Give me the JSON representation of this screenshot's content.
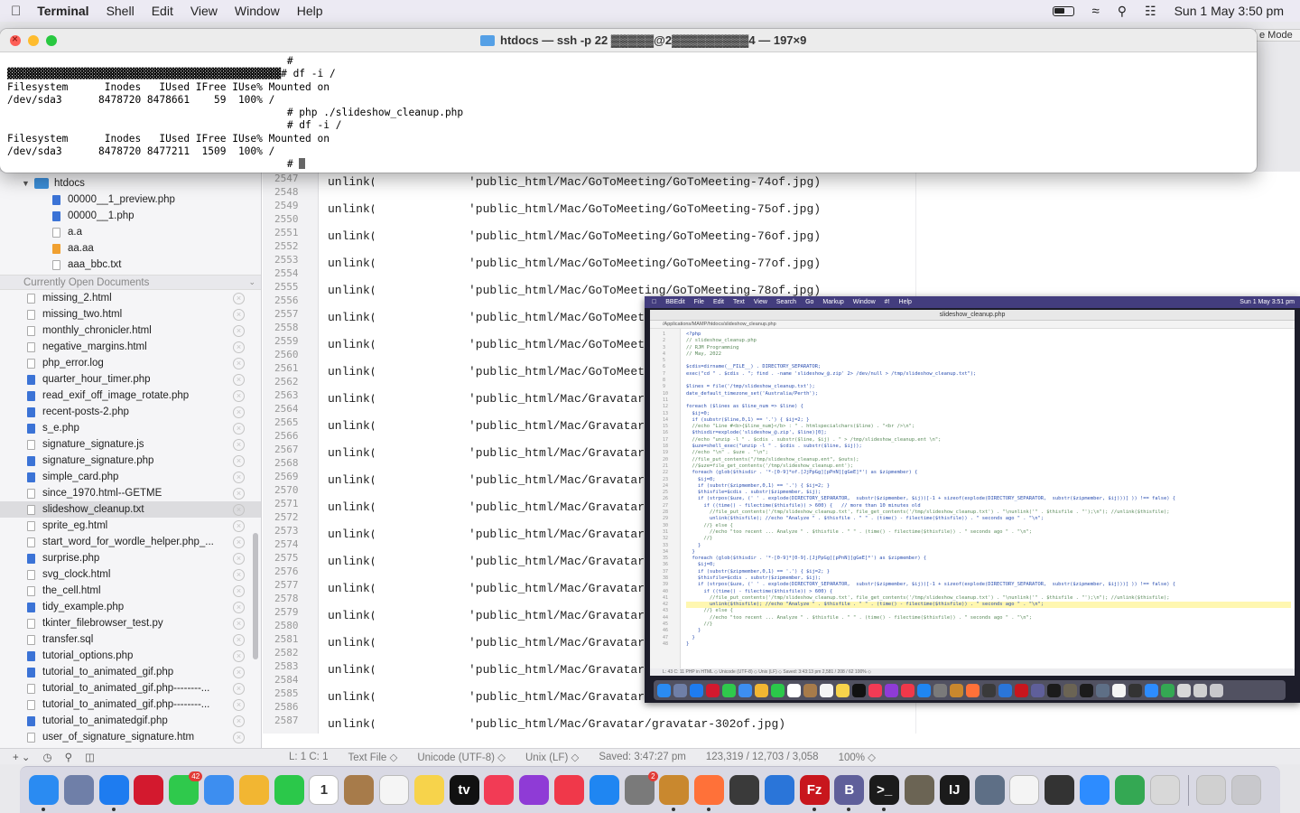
{
  "menubar": {
    "apple": "",
    "items": [
      "Terminal",
      "Shell",
      "Edit",
      "View",
      "Window",
      "Help"
    ],
    "clock": "Sun 1 May  3:50 pm"
  },
  "terminal": {
    "title": "htdocs — ssh -p 22 ▓▓▓▓▓@2▓▓▓▓▓▓▓▓▓4 — 197×9",
    "lines": [
      "                                              #",
      "▓▓▓▓▓▓▓▓▓▓▓▓▓▓▓▓▓▓▓▓▓▓▓▓▓▓▓▓▓▓▓▓▓▓▓▓▓▓▓▓▓▓▓▓▓# df -i /",
      "Filesystem      Inodes   IUsed IFree IUse% Mounted on",
      "/dev/sda3      8478720 8478661    59  100% /",
      "                                              # php ./slideshow_cleanup.php",
      "                                              # df -i /",
      "Filesystem      Inodes   IUsed IFree IUse% Mounted on",
      "/dev/sda3      8478720 8477211  1509  100% /",
      "                                              # "
    ],
    "behind_tab": "e Mode"
  },
  "sidebar": {
    "folder": "htdocs",
    "files": [
      {
        "name": "00000__1_preview.php",
        "type": "php"
      },
      {
        "name": "00000__1.php",
        "type": "php"
      },
      {
        "name": "a.a",
        "type": "txt"
      },
      {
        "name": "aa.aa",
        "type": "a"
      },
      {
        "name": "aaa_bbc.txt",
        "type": "txt"
      }
    ],
    "open_docs_header": "Currently Open Documents",
    "open_docs": [
      {
        "name": "missing_2.html",
        "type": "txt"
      },
      {
        "name": "missing_two.html",
        "type": "txt"
      },
      {
        "name": "monthly_chronicler.html",
        "type": "txt"
      },
      {
        "name": "negative_margins.html",
        "type": "txt"
      },
      {
        "name": "php_error.log",
        "type": "txt"
      },
      {
        "name": "quarter_hour_timer.php",
        "type": "php"
      },
      {
        "name": "read_exif_off_image_rotate.php",
        "type": "php"
      },
      {
        "name": "recent-posts-2.php",
        "type": "php"
      },
      {
        "name": "s_e.php",
        "type": "php"
      },
      {
        "name": "signature_signature.js",
        "type": "txt"
      },
      {
        "name": "signature_signature.php",
        "type": "php"
      },
      {
        "name": "simple_card.php",
        "type": "php"
      },
      {
        "name": "since_1970.html--GETME",
        "type": "txt"
      },
      {
        "name": "slideshow_cleanup.txt",
        "type": "txt",
        "selected": true
      },
      {
        "name": "sprite_eg.html",
        "type": "txt"
      },
      {
        "name": "start_word_for_wordle_helper.php_...",
        "type": "txt"
      },
      {
        "name": "surprise.php",
        "type": "php"
      },
      {
        "name": "svg_clock.html",
        "type": "txt"
      },
      {
        "name": "the_cell.html",
        "type": "txt"
      },
      {
        "name": "tidy_example.php",
        "type": "php"
      },
      {
        "name": "tkinter_filebrowser_test.py",
        "type": "txt"
      },
      {
        "name": "transfer.sql",
        "type": "txt"
      },
      {
        "name": "tutorial_options.php",
        "type": "php"
      },
      {
        "name": "tutorial_to_animated_gif.php",
        "type": "php"
      },
      {
        "name": "tutorial_to_animated_gif.php--------...",
        "type": "txt"
      },
      {
        "name": "tutorial_to_animated_gif.php--------...",
        "type": "txt"
      },
      {
        "name": "tutorial_to_animatedgif.php",
        "type": "php"
      },
      {
        "name": "user_of_signature_signature.htm",
        "type": "txt"
      },
      {
        "name": "user_of_signature_signature.html",
        "type": "txt"
      }
    ]
  },
  "editor": {
    "line_start": 2547,
    "line_end": 2587,
    "code_lines": [
      {
        "fn": "unlink(",
        "path": "'public_html/Mac/GoToMeeting/GoToMeeting-74of.jpg)"
      },
      {
        "fn": "unlink(",
        "path": "'public_html/Mac/GoToMeeting/GoToMeeting-75of.jpg)"
      },
      {
        "fn": "unlink(",
        "path": "'public_html/Mac/GoToMeeting/GoToMeeting-76of.jpg)"
      },
      {
        "fn": "unlink(",
        "path": "'public_html/Mac/GoToMeeting/GoToMeeting-77of.jpg)"
      },
      {
        "fn": "unlink(",
        "path": "'public_html/Mac/GoToMeeting/GoToMeeting-78of.jpg)"
      },
      {
        "fn": "unlink(",
        "path": "'public_html/Mac/GoToMeeting"
      },
      {
        "fn": "unlink(",
        "path": "'public_html/Mac/GoToMeeting"
      },
      {
        "fn": "unlink(",
        "path": "'public_html/Mac/GoToMeeting"
      },
      {
        "fn": "unlink(",
        "path": "'public_html/Mac/Gravatar/gr"
      },
      {
        "fn": "unlink(",
        "path": "'public_html/Mac/Gravatar/gr"
      },
      {
        "fn": "unlink(",
        "path": "'public_html/Mac/Gravatar/gr"
      },
      {
        "fn": "unlink(",
        "path": "'public_html/Mac/Gravatar/gr"
      },
      {
        "fn": "unlink(",
        "path": "'public_html/Mac/Gravatar/gr"
      },
      {
        "fn": "unlink(",
        "path": "'public_html/Mac/Gravatar/gr"
      },
      {
        "fn": "unlink(",
        "path": "'public_html/Mac/Gravatar/gr"
      },
      {
        "fn": "unlink(",
        "path": "'public_html/Mac/Gravatar/gr"
      },
      {
        "fn": "unlink(",
        "path": "'public_html/Mac/Gravatar/gr"
      },
      {
        "fn": "unlink(",
        "path": "'public_html/Mac/Gravatar/gr"
      },
      {
        "fn": "unlink(",
        "path": "'public_html/Mac/Gravatar/gr"
      },
      {
        "fn": "unlink(",
        "path": "'public_html/Mac/Gravatar/gr"
      },
      {
        "fn": "unlink(",
        "path": "'public_html/Mac/Gravatar/gravatar-302of.jpg)"
      }
    ]
  },
  "statusbar": {
    "position": "L: 1 C: 1",
    "type": "Text File ◇",
    "encoding": "Unicode (UTF-8) ◇",
    "line_endings": "Unix (LF) ◇",
    "saved": "Saved: 3:47:27 pm",
    "counts": "123,319 / 12,703 / 3,058",
    "zoom": "100% ◇"
  },
  "thumbnail": {
    "menubar": [
      "BBEdit",
      "File",
      "Edit",
      "Text",
      "View",
      "Search",
      "Go",
      "Markup",
      "Window",
      "#!",
      "Help"
    ],
    "clock": "Sun 1 May 3:51 pm",
    "title": "slideshow_cleanup.php",
    "path": "/Applications/MAMP/htdocs/slideshow_cleanup.php",
    "status": "L: 43 C: 11     PHP in HTML ◇     Unicode (UTF-8) ◇     Unix (LF) ◇     Saved: 3:43:13 pm     2,581 / 208 / 62     100% ◇",
    "code": [
      {
        "t": "<?php",
        "c": false
      },
      {
        "t": "// slideshow_cleanup.php",
        "c": true
      },
      {
        "t": "// RJM Programming",
        "c": true
      },
      {
        "t": "// May, 2022",
        "c": true
      },
      {
        "t": "",
        "c": false
      },
      {
        "t": "$cdis=dirname(__FILE__) . DIRECTORY_SEPARATOR;",
        "c": false
      },
      {
        "t": "exec(\"cd \" . $cdis . \"; find . -name 'slideshow_@.zip' 2> /dev/null > /tmp/slideshow_cleanup.txt\");",
        "c": false
      },
      {
        "t": "",
        "c": false
      },
      {
        "t": "$lines = file('/tmp/slideshow_cleanup.txt');",
        "c": false
      },
      {
        "t": "date_default_timezone_set('Australia/Perth');",
        "c": false
      },
      {
        "t": "",
        "c": false
      },
      {
        "t": "foreach ($lines as $line_num => $line) {",
        "c": false
      },
      {
        "t": "  $ij=0;",
        "c": false
      },
      {
        "t": "  if (substr($line,0,1) == '.') { $ij=2; }",
        "c": false
      },
      {
        "t": "  //echo \"Line #<b>{$line_num}</b> : \" . htmlspecialchars($line) . \"<br />\\n\";",
        "c": true
      },
      {
        "t": "  $thisdir=explode('slideshow_@.zip', $line)[0];",
        "c": false
      },
      {
        "t": "  //echo \"unzip -l \" . $cdis . substr($line, $ij) . \" > /tmp/slideshow_cleanup.ent \\n\";",
        "c": true
      },
      {
        "t": "  $uze=shell_exec(\"unzip -l \" . $cdis . substr($line, $ij));",
        "c": false
      },
      {
        "t": "  //echo \"\\n\" . $uze . \"\\n\";",
        "c": true
      },
      {
        "t": "  //file_put_contents(\"/tmp/slideshow_cleanup.ent\", $outs);",
        "c": true
      },
      {
        "t": "  //$uze=file_get_contents('/tmp/slideshow_cleanup.ent');",
        "c": true
      },
      {
        "t": "  foreach (glob($thisdir . '*-[0-9]*of.[JjPpGg][pPnN][gGeE]*') as $zipmember) {",
        "c": false
      },
      {
        "t": "    $ij=0;",
        "c": false
      },
      {
        "t": "    if (substr($zipmember,0,1) == '.') { $ij=2; }",
        "c": false
      },
      {
        "t": "    $thisfile=$cdis . substr($zipmember, $ij);",
        "c": false
      },
      {
        "t": "    if (strpos($uze, (' ' . explode(DIRECTORY_SEPARATOR,  substr($zipmember, $ij))[-1 + sizeof(explode(DIRECTORY_SEPARATOR,  substr($zipmember, $ij)))] )) !== false) {",
        "c": false
      },
      {
        "t": "      if ((time() - filectime($thisfile)) > 600) {   // more than 10 minutes old",
        "c": false
      },
      {
        "t": "        //file_put_contents('/tmp/slideshow_cleanup.txt', file_get_contents('/tmp/slideshow_cleanup.txt') . \"\\nunlink('\" . $thisfile . \"');\\n\"); //unlink($thisfile);",
        "c": true
      },
      {
        "t": "        unlink($thisfile); //echo \"Analyze \" . $thisfile . \" \" . (time() - filectime($thisfile)) . \" seconds ago \" . \"\\n\";",
        "c": false
      },
      {
        "t": "      //} else {",
        "c": true
      },
      {
        "t": "        //echo \"too recent ... Analyze \" . $thisfile . \" \" . (time() - filectime($thisfile)) . \" seconds ago \" . \"\\n\";",
        "c": true
      },
      {
        "t": "      //}",
        "c": true
      },
      {
        "t": "    }",
        "c": false
      },
      {
        "t": "  }",
        "c": false
      },
      {
        "t": "  foreach (glob($thisdir . '*-[0-9]*[0-9].[JjPpGg][pPnN][gGeE]*') as $zipmember) {",
        "c": false
      },
      {
        "t": "    $ij=0;",
        "c": false
      },
      {
        "t": "    if (substr($zipmember,0,1) == '.') { $ij=2; }",
        "c": false
      },
      {
        "t": "    $thisfile=$cdis . substr($zipmember, $ij);",
        "c": false
      },
      {
        "t": "    if (strpos($uze, (' ' . explode(DIRECTORY_SEPARATOR,  substr($zipmember, $ij))[-1 + sizeof(explode(DIRECTORY_SEPARATOR,  substr($zipmember, $ij)))] )) !== false) {",
        "c": false
      },
      {
        "t": "      if ((time() - filectime($thisfile)) > 600) {",
        "c": false
      },
      {
        "t": "        //file_put_contents('/tmp/slideshow_cleanup.txt', file_get_contents('/tmp/slideshow_cleanup.txt') . \"\\nunlink('\" . $thisfile . \"');\\n\"); //unlink($thisfile);",
        "c": true
      },
      {
        "t": "        unlink($thisfile); //echo \"Analyze \" . $thisfile . \" \" . (time() - filectime($thisfile)) . \" seconds ago \" . \"\\n\";",
        "c": false,
        "hl": true
      },
      {
        "t": "      //} else {",
        "c": true
      },
      {
        "t": "        //echo \"too recent ... Analyze \" . $thisfile . \" \" . (time() - filectime($thisfile)) . \" seconds ago \" . \"\\n\";",
        "c": true
      },
      {
        "t": "      //}",
        "c": true
      },
      {
        "t": "    }",
        "c": false
      },
      {
        "t": "  }",
        "c": false
      },
      {
        "t": "}",
        "c": false
      }
    ]
  },
  "dock": {
    "apps": [
      {
        "name": "Finder",
        "color": "#2a8bf2",
        "running": true
      },
      {
        "name": "Launchpad",
        "color": "#6f7fa8"
      },
      {
        "name": "Safari",
        "color": "#1e7cf0",
        "running": true
      },
      {
        "name": "Opera",
        "color": "#d3192e"
      },
      {
        "name": "Messages",
        "color": "#2fc94c",
        "badge": "42"
      },
      {
        "name": "Mail",
        "color": "#3d8ef0"
      },
      {
        "name": "Photos",
        "color": "#f2b632"
      },
      {
        "name": "FaceTime",
        "color": "#2bc84a"
      },
      {
        "name": "Calendar",
        "color": "#ffffff",
        "label": "1"
      },
      {
        "name": "Contacts",
        "color": "#a77b4a"
      },
      {
        "name": "Reminders",
        "color": "#f5f5f5"
      },
      {
        "name": "Notes",
        "color": "#f7d34b"
      },
      {
        "name": "TV",
        "color": "#111111",
        "label": "tv"
      },
      {
        "name": "Music",
        "color": "#f23b55"
      },
      {
        "name": "Podcasts",
        "color": "#8f3bd6"
      },
      {
        "name": "News",
        "color": "#f0384a"
      },
      {
        "name": "App Store",
        "color": "#1f86f2"
      },
      {
        "name": "System Preferences",
        "color": "#7a7a7a",
        "badge": "2"
      },
      {
        "name": "Preview",
        "color": "#c9882e",
        "running": true
      },
      {
        "name": "Firefox",
        "color": "#ff7139",
        "running": true
      },
      {
        "name": "Calculator",
        "color": "#3a3a3a"
      },
      {
        "name": "Xcode",
        "color": "#2a75d9"
      },
      {
        "name": "FileZilla",
        "color": "#c8161d",
        "label": "Fz",
        "running": true
      },
      {
        "name": "BBEdit",
        "color": "#5f5f9a",
        "label": "B",
        "running": true
      },
      {
        "name": "Terminal",
        "color": "#1b1b1b",
        "label": ">_",
        "running": true
      },
      {
        "name": "GIMP",
        "color": "#6b6454"
      },
      {
        "name": "IntelliJ",
        "color": "#1b1b1b",
        "label": "IJ"
      },
      {
        "name": "Screenshot",
        "color": "#5e6f86"
      },
      {
        "name": "TextEdit",
        "color": "#f4f4f4"
      },
      {
        "name": "Tux",
        "color": "#333333"
      },
      {
        "name": "Zoom",
        "color": "#2d8cff"
      },
      {
        "name": "Chrome",
        "color": "#34a853"
      },
      {
        "name": "Script Editor",
        "color": "#d8d8d8"
      }
    ],
    "trailing": [
      {
        "name": "Downloads",
        "color": "#d0d0d0"
      },
      {
        "name": "Trash",
        "color": "#c8c8cc"
      }
    ]
  }
}
